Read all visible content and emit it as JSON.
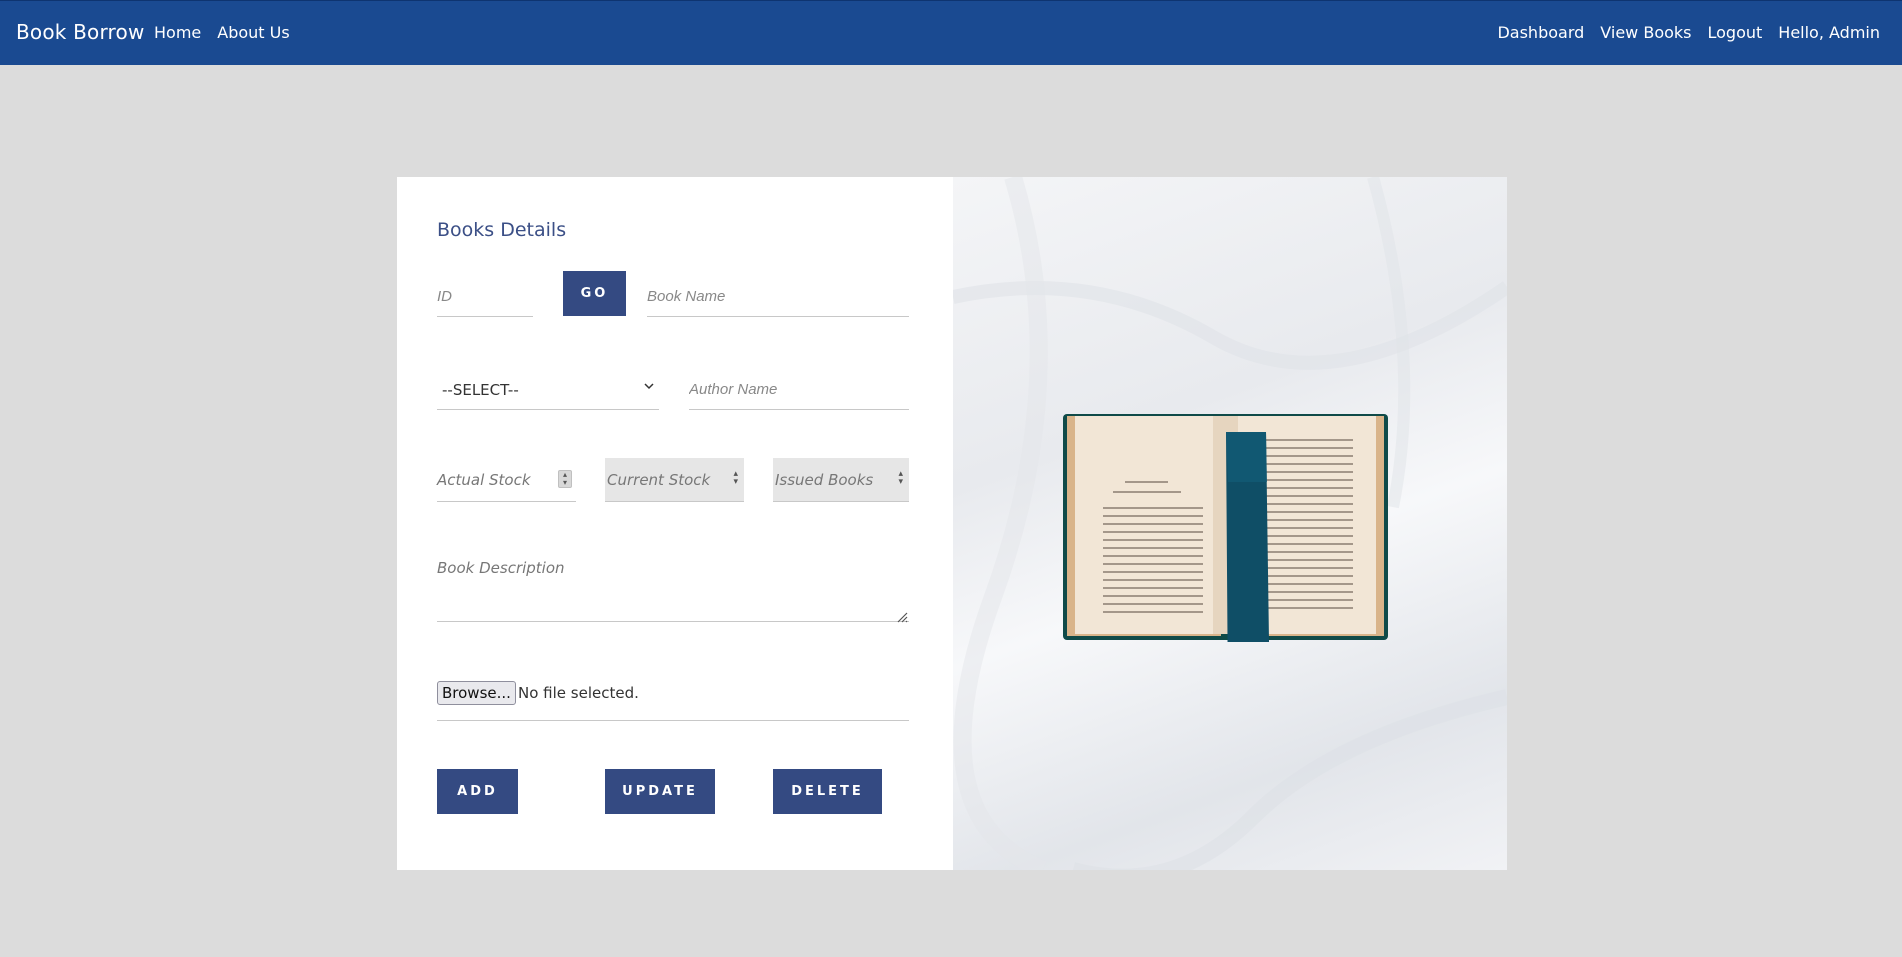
{
  "navbar": {
    "brand": "Book Borrow",
    "left_links": [
      "Home",
      "About Us"
    ],
    "right_links": [
      "Dashboard",
      "View Books",
      "Logout",
      "Hello, Admin"
    ]
  },
  "form": {
    "title": "Books Details",
    "id_placeholder": "ID",
    "go_label": "GO",
    "book_name_placeholder": "Book Name",
    "select_value": "--SELECT--",
    "author_placeholder": "Author Name",
    "actual_stock_placeholder": "Actual Stock",
    "current_stock_placeholder": "Current Stock",
    "issued_books_placeholder": "Issued Books",
    "description_placeholder": "Book Description",
    "browse_label": "Browse...",
    "file_status": "No file selected.",
    "add_label": "ADD",
    "update_label": "UPDATE",
    "delete_label": "DELETE"
  },
  "colors": {
    "navbar": "#1a4a91",
    "button": "#344a82",
    "title": "#3b4f86",
    "background": "#dcdcdc"
  },
  "image": {
    "subject": "open-book-with-ribbon-bookmark-on-white-sheets"
  }
}
